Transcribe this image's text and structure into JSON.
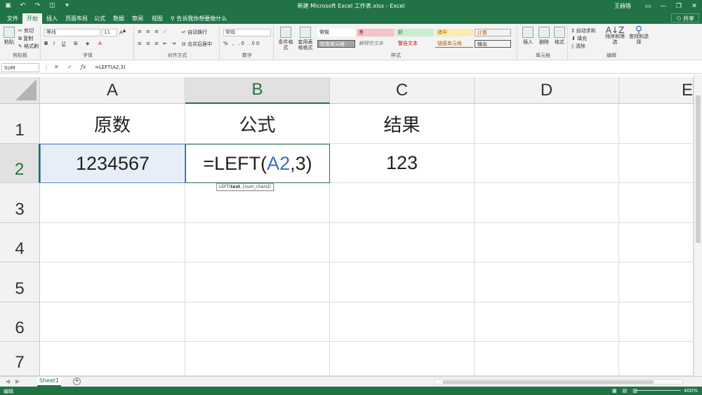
{
  "titlebar": {
    "title": "新建 Microsoft Excel 工作表.xlsx  -  Excel",
    "user": "王赫恪"
  },
  "tabs": [
    {
      "label": "文件"
    },
    {
      "label": "开始"
    },
    {
      "label": "插入"
    },
    {
      "label": "页面布局"
    },
    {
      "label": "公式"
    },
    {
      "label": "数据"
    },
    {
      "label": "审阅"
    },
    {
      "label": "视图"
    }
  ],
  "tell_me": "告诉我你想要做什么",
  "share": "共享",
  "ribbon": {
    "clipboard": {
      "paste": "粘贴",
      "cut": "剪切",
      "copy": "复制",
      "format_painter": "格式刷",
      "label": "剪贴板"
    },
    "font": {
      "name": "等线",
      "size": "11",
      "label": "字体"
    },
    "alignment": {
      "wrap": "自动换行",
      "merge": "合并后居中",
      "label": "对齐方式"
    },
    "number": {
      "format": "常规",
      "label": "数字"
    },
    "styles": {
      "conditional": "条件格式",
      "table": "套用表格格式",
      "boxes": [
        "常规",
        "差",
        "好",
        "适中",
        "计算",
        "检查单元格",
        "解释性文本",
        "警告文本",
        "链接单元格",
        "输出"
      ],
      "label": "样式"
    },
    "cells": {
      "insert": "插入",
      "delete": "删除",
      "format": "格式",
      "label": "单元格"
    },
    "editing": {
      "autosum": "自动求和",
      "fill": "填充",
      "clear": "清除",
      "sort": "排序和筛选",
      "find": "查找和选择",
      "label": "编辑"
    }
  },
  "formula_bar": {
    "name_box": "SUM",
    "formula": "=LEFT(A2,3)"
  },
  "columns": [
    "A",
    "B",
    "C",
    "D",
    "E"
  ],
  "rows": [
    "1",
    "2",
    "3",
    "4",
    "5",
    "6",
    "7"
  ],
  "cells": {
    "A1": "原数",
    "B1": "公式",
    "C1": "结果",
    "A2": "1234567",
    "B2_prefix": "=LEFT(",
    "B2_ref": "A2",
    "B2_suffix": ",3)",
    "C2": "123"
  },
  "tooltip": {
    "func": "LEFT(",
    "arg1": "text",
    "rest": ", [num_chars])"
  },
  "sheet_tab": "Sheet1",
  "status": {
    "mode": "编辑",
    "zoom": "400%"
  },
  "colors": {
    "accent": "#217346",
    "ref_blue": "#3c6fb4",
    "selected_fill": "#e8eef8"
  }
}
